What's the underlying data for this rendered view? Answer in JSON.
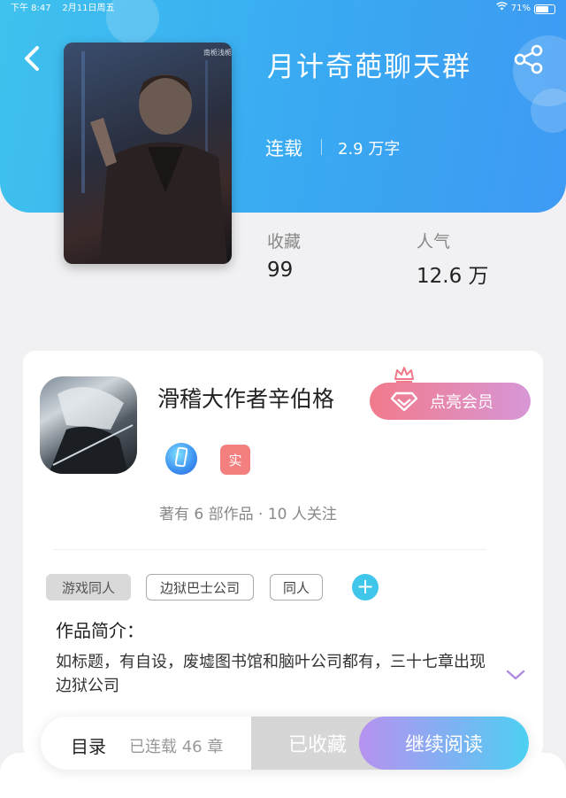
{
  "status_bar": {
    "time": "下午 8:47",
    "date": "2月11日周五",
    "battery": "71%",
    "battery_level": 0.71
  },
  "book": {
    "title": "月计奇葩聊天群",
    "status": "连载",
    "word_count": "2.9 万字",
    "cover_watermark": "南栀浅栀"
  },
  "stats": [
    {
      "label": "收藏",
      "value": "99"
    },
    {
      "label": "人气",
      "value": "12.6 万"
    }
  ],
  "author": {
    "name": "滑稽大作者辛伯格",
    "badge_real": "实",
    "meta": "著有 6 部作品 · 10 人关注"
  },
  "vip": {
    "label": "点亮会员"
  },
  "tags": [
    "游戏同人",
    "边狱巴士公司",
    "同人"
  ],
  "intro": {
    "title": "作品简介：",
    "text": "如标题，有自设，废墟图书馆和脑叶公司都有，三十七章出现边狱公司"
  },
  "bottom_bar": {
    "toc_label": "目录",
    "chapter_count": "已连载 46 章",
    "collected_label": "已收藏",
    "continue_label": "继续阅读"
  },
  "colors": {
    "header": "#39a9f2",
    "accent_cyan": "#3fc6ea",
    "vip_pink": "#f27a8c",
    "real_badge": "#f47f7f"
  }
}
